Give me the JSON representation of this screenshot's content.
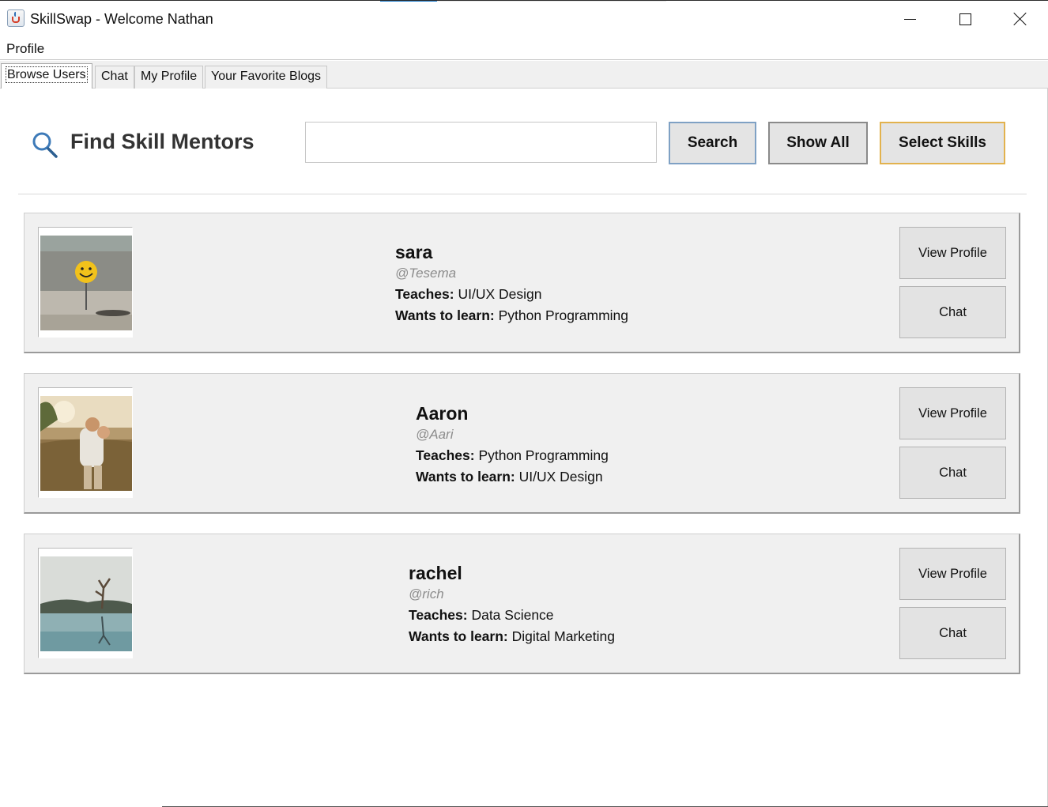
{
  "window": {
    "title": "SkillSwap - Welcome Nathan"
  },
  "menu": {
    "items": [
      "Profile"
    ]
  },
  "tabs": [
    {
      "label": "Browse Users",
      "active": true
    },
    {
      "label": "Chat",
      "active": false
    },
    {
      "label": "My Profile",
      "active": false
    },
    {
      "label": "Your Favorite Blogs",
      "active": false
    }
  ],
  "header": {
    "title": "Find Skill Mentors",
    "search_value": "",
    "search_button": "Search",
    "show_all_button": "Show All",
    "select_skills_button": "Select Skills"
  },
  "users": [
    {
      "name": "sara",
      "handle": "@Tesema",
      "teaches_label": "Teaches:",
      "teaches": "UI/UX Design",
      "learn_label": "Wants to learn:",
      "learn": "Python Programming",
      "view_button": "View Profile",
      "chat_button": "Chat"
    },
    {
      "name": "Aaron",
      "handle": "@Aari",
      "teaches_label": "Teaches:",
      "teaches": "Python Programming",
      "learn_label": "Wants to learn:",
      "learn": "UI/UX Design",
      "view_button": "View Profile",
      "chat_button": "Chat"
    },
    {
      "name": "rachel",
      "handle": "@rich",
      "teaches_label": "Teaches:",
      "teaches": "Data Science",
      "learn_label": "Wants to learn:",
      "learn": "Digital Marketing",
      "view_button": "View Profile",
      "chat_button": "Chat"
    }
  ],
  "colors": {
    "search_button_border": "#7fa1c4",
    "select_skills_border": "#e2b24e",
    "card_background": "#f0f0f0"
  }
}
